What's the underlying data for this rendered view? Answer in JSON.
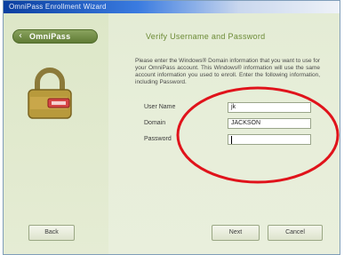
{
  "window": {
    "title": "OmniPass Enrollment Wizard"
  },
  "brand": {
    "name": "OmniPass"
  },
  "header": {
    "title": "Verify Username and Password"
  },
  "instructions": {
    "text": "Please enter the Windows® Domain information that you want to use for your OmniPass account. This Windows® information will use the same account information you used to enroll. Enter the following information, including Password."
  },
  "form": {
    "user_name_label": "User Name",
    "user_name_value": "jk",
    "domain_label": "Domain",
    "domain_value": "JACKSON",
    "password_label": "Password",
    "password_value": ""
  },
  "buttons": {
    "back": "Back",
    "next": "Next",
    "cancel": "Cancel"
  },
  "colors": {
    "accent_green": "#6b8a35",
    "annotation_red": "#e0131b"
  }
}
